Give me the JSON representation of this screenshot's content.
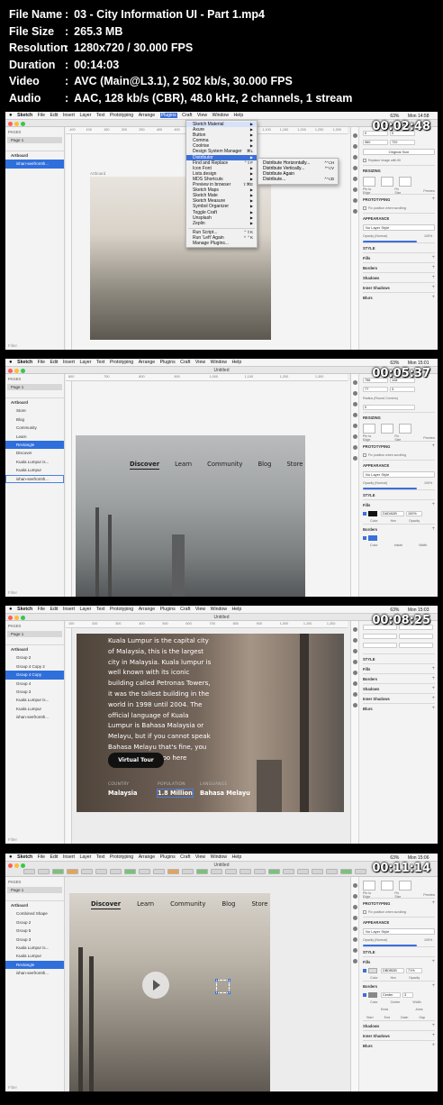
{
  "file_info": [
    {
      "key": "File Name",
      "value": "03 - City Information UI - Part 1.mp4"
    },
    {
      "key": "File Size",
      "value": "265.3 MB"
    },
    {
      "key": "Resolution",
      "value": "1280x720 / 30.000 FPS"
    },
    {
      "key": "Duration",
      "value": "00:14:03"
    },
    {
      "key": "Video",
      "value": "AVC (Main@L3.1), 2 502 kb/s, 30.000 FPS"
    },
    {
      "key": "Audio",
      "value": "AAC, 128 kb/s (CBR), 48.0 kHz, 2 channels, 1 stream"
    }
  ],
  "separator": ":",
  "menubar": {
    "app": "Sketch",
    "items": [
      "File",
      "Edit",
      "Insert",
      "Layer",
      "Text",
      "Prototyping",
      "Arrange",
      "Plugins",
      "Craft",
      "View",
      "Window",
      "Help"
    ],
    "battery": "63%"
  },
  "window_title": "Untitled",
  "common": {
    "pages_header": "PAGES",
    "page1": "Page 1",
    "artboard": "Artboard",
    "filter": "Filter"
  },
  "frames": [
    {
      "timestamp": "00:02:48",
      "clock": "Mon 14:58",
      "artboard_label": "Artboard",
      "ruler": [
        "-100",
        "100",
        "150",
        "200",
        "250",
        "400",
        "450",
        "500",
        "900",
        "1,000",
        "1,050",
        "1,100",
        "1,150",
        "1,200",
        "1,250",
        "1,300"
      ],
      "layers": [
        "Artboard",
        "ishan-seefromth..."
      ],
      "plugins_menu": [
        "Sketch Material",
        "Axure",
        "Button",
        "Comma",
        "Coolrise",
        "Design System Manager",
        "Distributor",
        "Find and Replace",
        "Icon Font",
        "Lists.design",
        "MDS Shortcuts",
        "Preview in browser",
        "Sketch Maps",
        "Sketch Mate",
        "Sketch Measure",
        "Symbol Organizer",
        "Toggle Craft",
        "Unsplash",
        "Zeplin",
        "Run Script...",
        "Run 'Left' Again",
        "Manage Plugins..."
      ],
      "plugins_shortcuts": {
        "5": "⌘L",
        "7": "⌃⇧F",
        "11": "⇧⌘E",
        "19": "⌃⇧K",
        "20": "^ ⌃K"
      },
      "distributor_sub": [
        {
          "label": "Distribute Horizontally...",
          "sc": "^⌥H"
        },
        {
          "label": "Distribute Vertically...",
          "sc": "^⌥V"
        },
        {
          "label": "Distribute Again",
          "sc": ""
        },
        {
          "label": "Distribute...",
          "sc": "^⌥D"
        }
      ],
      "inspector": {
        "x": "0",
        "y": "0",
        "w": "960",
        "h": "720",
        "original": "Original Size",
        "replace": "Replace image with fill",
        "resizing": "RESIZING",
        "pin": "Pin to Edge",
        "fix": "Fix Size",
        "preview": "Preview",
        "prototyping": "PROTOTYPING",
        "fixpos": "Fix position when scrolling",
        "appearance": "APPEARANCE",
        "nolayer": "No Layer Style",
        "opacity": "Opacity (Normal)",
        "opacity_val": "100%",
        "style": "STYLE",
        "fills": "Fills",
        "borders": "Borders",
        "shadows": "Shadows",
        "inner": "Inner Shadows",
        "blurs": "Blurs"
      }
    },
    {
      "timestamp": "00:05:37",
      "clock": "Mon 15:01",
      "ruler": [
        "600",
        "700",
        "800",
        "900",
        "1,000",
        "1,100",
        "1,200",
        "1,300"
      ],
      "layers": [
        "Artboard",
        "Store",
        "Blog",
        "Community",
        "Learn",
        "Rectangle",
        "Discover",
        "Kuala Lumpur is...",
        "Kuala Lumpur",
        "ishan-seefromth..."
      ],
      "nav": [
        "Discover",
        "Learn",
        "Community",
        "Blog",
        "Store"
      ],
      "inspector": {
        "x": "756",
        "y": "108",
        "w": "77",
        "h": "3",
        "radius": "Radius (Round Corners)",
        "rval": "0",
        "resizing": "RESIZING",
        "pin": "Pin to Edge",
        "fix": "Fix Size",
        "preview": "Preview",
        "prototyping": "PROTOTYPING",
        "fixpos": "Fix position when scrolling",
        "appearance": "APPEARANCE",
        "nolayer": "No Layer Style",
        "opacity": "Opacity (Normal)",
        "opacity_val": "100%",
        "style": "STYLE",
        "fills": "Fills",
        "fillhex": "DADADB",
        "fillpct": "100%",
        "color": "Color",
        "hex": "Hex",
        "opc": "Opacity",
        "borders": "Borders",
        "inside": "Inside",
        "width": "Width",
        "bcolor": "Color"
      }
    },
    {
      "timestamp": "00:08:25",
      "clock": "Mon 15:03",
      "ruler": [
        "100",
        "200",
        "300",
        "400",
        "500",
        "600",
        "700",
        "800",
        "900",
        "1,000",
        "1,100",
        "1,200"
      ],
      "layers": [
        "Artboard",
        "Group 2",
        "Group 4 Copy 2",
        "Group 4 Copy",
        "Group 4",
        "Group 3",
        "Kuala Lumpur is...",
        "Kuala Lumpur",
        "ishan-seefromth..."
      ],
      "paragraph": "Kuala Lumpur is the capital city of Malaysia, this is the largest city in Malaysia. Kuala lumpur is well known with its iconic building called Petronas Towers, it was the tallest building in the world in 1998 until 2004. The official language of Kuala Lumpur is Bahasa Malaysia or Melayu, but if you cannot speak Bahasa Melayu that's fine, you can use English too here",
      "button": "Virtual Tour",
      "stats": [
        {
          "k": "COUNTRY",
          "v": "Malaysia"
        },
        {
          "k": "POPULATION",
          "v": "1.8 Million"
        },
        {
          "k": "LANGUANGE",
          "v": "Bahasa Melayu"
        }
      ],
      "inspector": {
        "style": "STYLE",
        "fills": "Fills",
        "borders": "Borders",
        "shadows": "Shadows",
        "inner": "Inner Shadows",
        "blurs": "Blurs"
      }
    },
    {
      "timestamp": "00:11:14",
      "clock": "Mon 15:06",
      "layers": [
        "Artboard",
        "Combined Shape",
        "Group 2",
        "Group 5",
        "Group 3",
        "Kuala Lumpur is...",
        "Kuala Lumpur",
        "Rectangle",
        "ishan-seefromth..."
      ],
      "nav": [
        "Discover",
        "Learn",
        "Community",
        "Blog",
        "Store"
      ],
      "inspector": {
        "pin": "Pin to Edge",
        "fix": "Fix Size",
        "preview": "Preview",
        "prototyping": "PROTOTYPING",
        "fixpos": "Fix position when scrolling",
        "appearance": "APPEARANCE",
        "nolayer": "No Layer Style",
        "opacity": "Opacity (Normal)",
        "opacity_val": "100%",
        "style": "STYLE",
        "fills": "Fills",
        "fillhex": "DBDBDB",
        "fillpct": "71%",
        "color": "Color",
        "hex": "Hex",
        "opc": "Opacity",
        "borders": "Borders",
        "center": "Center",
        "width": "Width",
        "bwidth": "3",
        "ends": "Ends",
        "joins": "Joins",
        "start": "Start",
        "end": "End",
        "dash": "Dash",
        "gap": "Gap",
        "shadows": "Shadows",
        "inner": "Inner Shadows",
        "blurs": "Blurs"
      }
    }
  ],
  "colors": {
    "accent": "#3b6fd9",
    "traffic_red": "#fc5f57",
    "traffic_yellow": "#fdbc2e",
    "traffic_green": "#34c84a"
  }
}
